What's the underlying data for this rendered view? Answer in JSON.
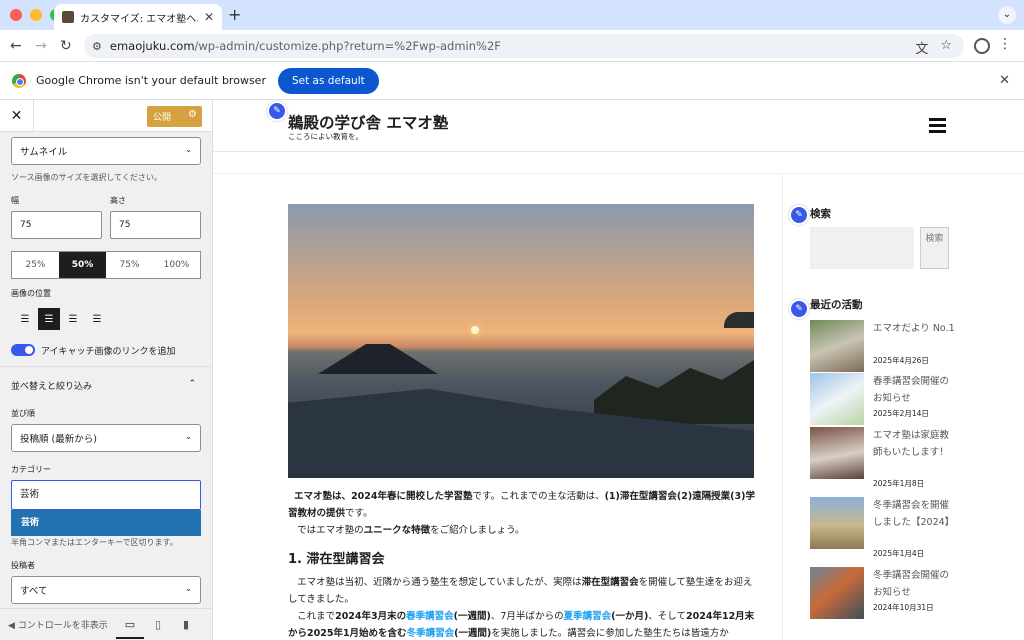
{
  "browser": {
    "tab_title": "カスタマイズ: エマオ塾へようこ",
    "url_host": "emaojuku.com",
    "url_path": "/wp-admin/customize.php?return=%2Fwp-admin%2F",
    "infobar_text": "Google Chrome isn't your default browser",
    "set_default_label": "Set as default"
  },
  "customizer": {
    "publish_label": "公開",
    "thumb_select": "サムネイル",
    "thumb_help": "ソース画像のサイズを選択してください。",
    "width_label": "幅",
    "width_value": "75",
    "height_label": "高さ",
    "height_value": "75",
    "sizes": [
      "25%",
      "50%",
      "75%",
      "100%"
    ],
    "size_selected": "50%",
    "image_position_label": "画像の位置",
    "link_toggle_label": "アイキャッチ画像のリンクを追加",
    "link_toggle_on": true,
    "sort_section_title": "並べ替えと絞り込み",
    "order_label": "並び順",
    "order_value": "投稿順 (最新から)",
    "category_label": "カテゴリー",
    "category_input": "芸術",
    "category_suggestion": "芸術",
    "category_help": "半角コンマまたはエンターキーで区切ります。",
    "author_label": "投稿者",
    "author_value": "すべて",
    "hide_controls": "コントロールを非表示"
  },
  "site": {
    "title": "鵜殿の学び舎 エマオ塾",
    "description": "こころによい教育を。",
    "intro_1": "エマオ塾は、",
    "intro_2": "2024年春に開校した学習塾",
    "intro_3": "です。これまでの主な活動は、",
    "intro_4": "(1)滞在型講習会(2)遠隔授業(3)学習教材の提供",
    "intro_5": "です。",
    "intro_6": "では",
    "intro_7": "エマオ塾の",
    "intro_8": "ユニークな特徴",
    "intro_9": "をご紹介しましょう。",
    "h2": "1. 滞在型講習会",
    "p_a": "エマオ塾は当初、近隣から通う塾生を想定していましたが、実際は",
    "p_b": "滞在型講習会",
    "p_c": "を開催して塾生達をお迎えしてきました。",
    "p_d": "これまで",
    "p_e": "2024年3月末の",
    "p_f": "春季講習会",
    "p_g": "(一週間)",
    "p_h": "、7月半ばからの",
    "p_i": "夏季講習会",
    "p_j": "(一か月)",
    "p_k": "、そして",
    "p_l": "2024年12月末から2025年1月始めを含む",
    "p_m": "冬季講習会",
    "p_n": "(一週間)",
    "p_o": "を実施しました。講習会に参加した塾生たちは皆遠方か",
    "search_title": "検索",
    "search_button": "検索",
    "recent_title": "最近の活動",
    "recent": [
      {
        "title": "エマオだより No.1",
        "date": "2025年4月26日"
      },
      {
        "title": "春季講習会開催のお知らせ",
        "date": "2025年2月14日"
      },
      {
        "title": "エマオ塾は家庭教師もいたします！",
        "date": "2025年1月8日"
      },
      {
        "title": "冬季講習会を開催しました【2024】",
        "date": "2025年1月4日"
      },
      {
        "title": "冬季講習会開催のお知らせ",
        "date": "2024年10月31日"
      }
    ]
  }
}
